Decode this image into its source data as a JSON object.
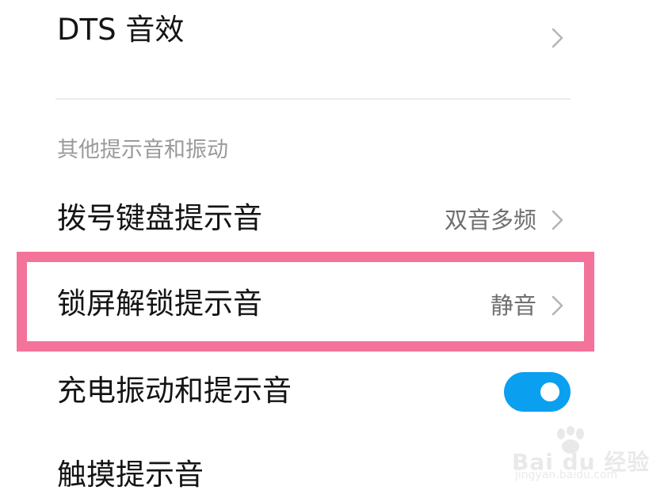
{
  "settings": {
    "dts": {
      "label": "DTS 音效"
    },
    "section_title": "其他提示音和振动",
    "dialpad": {
      "label": "拨号键盘提示音",
      "value": "双音多频"
    },
    "lockscreen": {
      "label": "锁屏解锁提示音",
      "value": "静音"
    },
    "charging": {
      "label": "充电振动和提示音",
      "toggle_on": true
    },
    "touch": {
      "label": "触摸提示音"
    }
  },
  "colors": {
    "highlight_border": "#f3739a",
    "toggle_on": "#0b9ff0",
    "section_title": "#9a9a9a",
    "value_text": "#6f6f6f"
  },
  "watermark": {
    "brand": "Bai du 经验",
    "site": "jingyan.baidu.com"
  }
}
